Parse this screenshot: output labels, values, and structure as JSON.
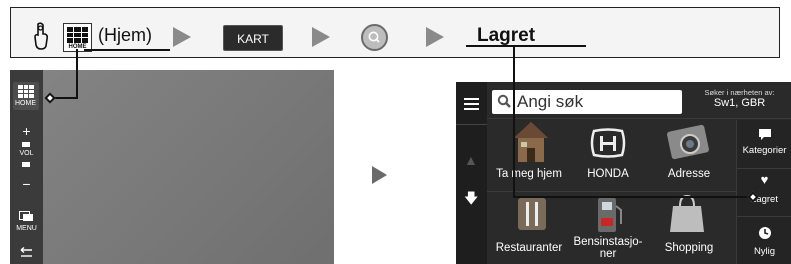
{
  "instruction_bar": {
    "home_icon_label": "HOME",
    "hjem_text": "(Hjem)",
    "kart_button_label": "KART",
    "lagret_label": "Lagret"
  },
  "left_screen": {
    "home_label": "HOME",
    "plus_symbol": "+",
    "vol_label": "VOL",
    "minus_symbol": "−",
    "menu_label": "MENU"
  },
  "right_screen": {
    "search_placeholder": "Angi søk",
    "near_label": "Søker i nærheten av:",
    "near_value": "Sw1, GBR",
    "tiles": [
      {
        "label": "Ta meg hjem"
      },
      {
        "label": "HONDA"
      },
      {
        "label": "Adresse"
      },
      {
        "label": "Restauranter"
      },
      {
        "label": "Bensinstasjo-\nner"
      },
      {
        "label": "Shopping"
      }
    ],
    "right_column": [
      {
        "label": "Kategorier",
        "icon": "chat-bubble-icon"
      },
      {
        "label": "Lagret",
        "icon": "heart-icon"
      },
      {
        "label": "Nylig",
        "icon": "clock-icon"
      }
    ]
  },
  "colors": {
    "bar_bg": "#f4f4f4",
    "map_bg": "#7a7a7a",
    "menu_bg": "#2a2a2a",
    "arrow": "#8a8a8a"
  }
}
